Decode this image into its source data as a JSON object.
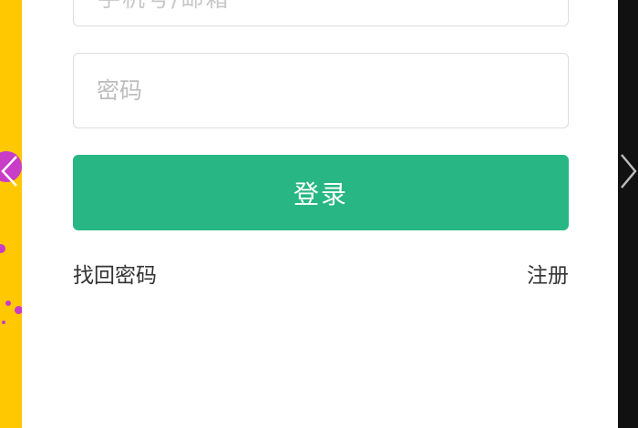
{
  "login_form": {
    "top_field_fragment": "手机号/邮箱",
    "password_placeholder": "密码",
    "login_button": "登录",
    "find_password_link": "找回密码",
    "register_link": "注册"
  },
  "colors": {
    "login_button": "#28b784",
    "left_background": "#ffc800",
    "decor_dots": "#c83cc8",
    "right_background": "#111111"
  },
  "icons": {
    "left_nav": "chevron-left-icon",
    "right_nav": "chevron-right-icon"
  }
}
